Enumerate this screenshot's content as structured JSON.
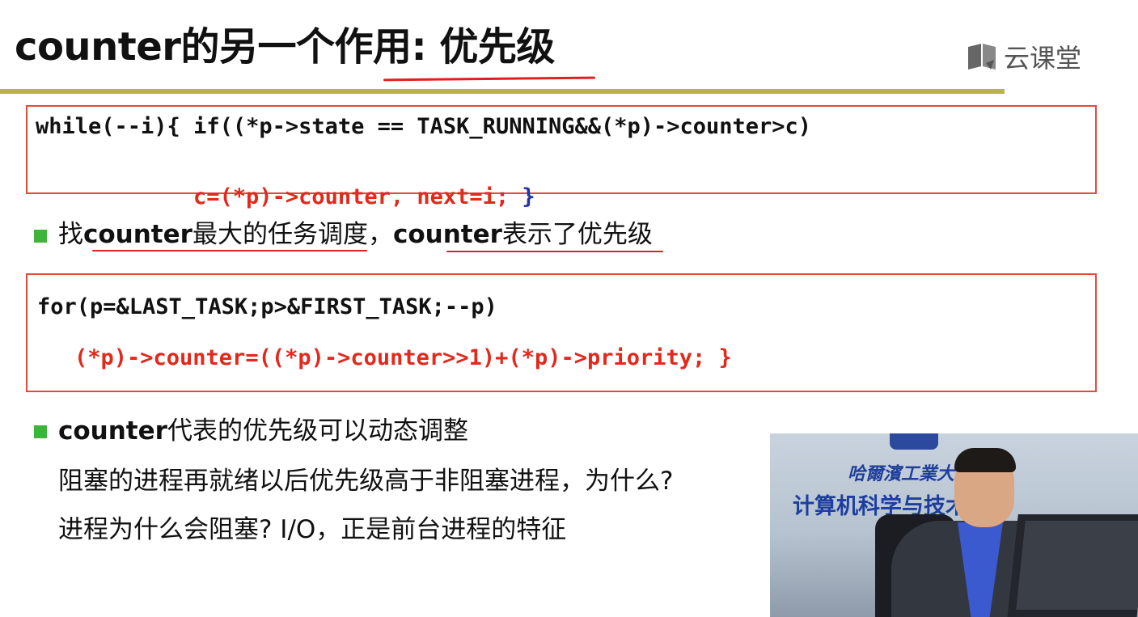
{
  "slide": {
    "title": "counter的另一个作用: 优先级",
    "brand": "云课堂",
    "brand_icon": "book-icon"
  },
  "code_block_1": {
    "line1": "while(--i){ if((*p->state == TASK_RUNNING&&(*p)->counter>c)",
    "line2_part1": "c=(*p)->counter, next=i; ",
    "line2_part2": "}"
  },
  "bullet_1": {
    "prefix": "找",
    "kw1": "counter",
    "mid": "最大的任务调度，",
    "kw2": "counter",
    "suffix": "表示了优先级"
  },
  "code_block_2": {
    "line1": "for(p=&LAST_TASK;p>&FIRST_TASK;--p)",
    "line2": "(*p)->counter=((*p)->counter>>1)+(*p)->priority; }"
  },
  "bullet_2": {
    "kw": "counter",
    "text": "代表的优先级可以动态调整",
    "line2": "阻塞的进程再就绪以后优先级高于非阻塞进程，为什么?",
    "line3": "进程为什么会阻塞? I/O，正是前台进程的特征"
  },
  "video": {
    "sign_top": "哈爾濱工業大",
    "sign_main": "计算机科学与技术学院"
  },
  "colors": {
    "accent_rule": "#b9b34a",
    "code_border": "#e34a3a",
    "code_red": "#e3281c",
    "code_blue": "#2233aa",
    "bullet_green": "#3db53a"
  }
}
